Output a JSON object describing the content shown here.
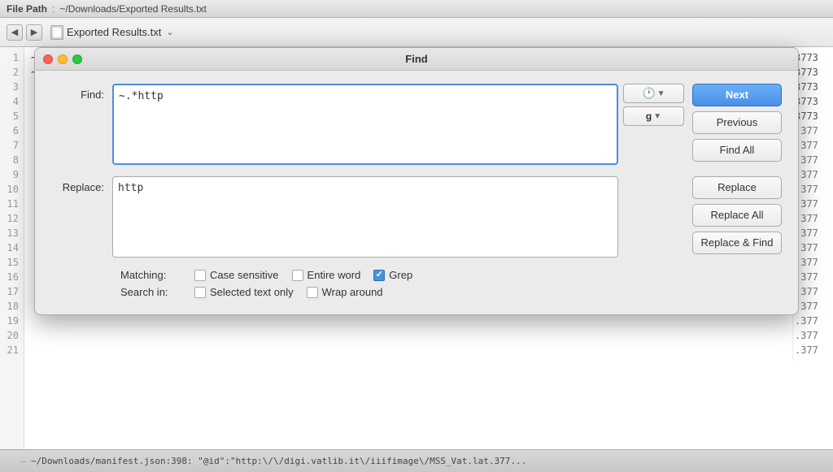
{
  "titlebar": {
    "file_path_label": "File Path",
    "separator": ":",
    "path": "~/Downloads/Exported Results.txt"
  },
  "toolbar": {
    "file_name": "Exported Results.txt",
    "back_icon": "◀",
    "forward_icon": "▶",
    "dropdown_icon": "⌄"
  },
  "editor": {
    "lines": [
      {
        "num": "1",
        "text": "~/Downloads/manifest.json:24: \"@id\":\"http:\\/\\/digi.vatlib.it\\/iiifimage\\/MSS_Vat.lat.3773"
      },
      {
        "num": "2",
        "text": "~/Downloads/manifest.json:41: \"@id\":\"http:\\/\\/digi.vatlib.it\\/iiifimage\\/MSS_Vat.lat.3773"
      },
      {
        "num": "3",
        "text": "                                                                                                   3773"
      },
      {
        "num": "4",
        "text": "                                                                                                   3773"
      },
      {
        "num": "5",
        "text": "                                                                                                   3773"
      },
      {
        "num": "6",
        "text": "                                                                                                    .377"
      },
      {
        "num": "7",
        "text": "                                                                                                    .377"
      },
      {
        "num": "8",
        "text": "                                                                                                    .377"
      },
      {
        "num": "9",
        "text": "                                                                                                    .377"
      },
      {
        "num": "10",
        "text": "                                                                                                   .377"
      },
      {
        "num": "11",
        "text": "                                                                                                   .377"
      },
      {
        "num": "12",
        "text": "                                                                                                   .377"
      },
      {
        "num": "13",
        "text": "                                                                                                   .377"
      },
      {
        "num": "14",
        "text": "                                                                                                   .377"
      },
      {
        "num": "15",
        "text": "                                                                                                   .377"
      },
      {
        "num": "16",
        "text": "                                                                                                   .377"
      },
      {
        "num": "17",
        "text": "                                                                                                   .377"
      },
      {
        "num": "18",
        "text": "                                                                                                   .377"
      },
      {
        "num": "19",
        "text": "                                                                                                   .377"
      },
      {
        "num": "20",
        "text": "                                                                                                   .377"
      },
      {
        "num": "21",
        "text": "                                                                                                   .377"
      }
    ]
  },
  "find_dialog": {
    "title": "Find",
    "find_label": "Find:",
    "replace_label": "Replace:",
    "find_value": "~.*http",
    "replace_value": "http",
    "history_icon": "🕐",
    "regex_icon": "g",
    "next_label": "Next",
    "previous_label": "Previous",
    "find_all_label": "Find All",
    "replace_label_btn": "Replace",
    "replace_all_label": "Replace All",
    "replace_find_label": "Replace & Find",
    "matching_label": "Matching:",
    "search_in_label": "Search in:",
    "options": {
      "case_sensitive": {
        "label": "Case sensitive",
        "checked": false
      },
      "entire_word": {
        "label": "Entire word",
        "checked": false
      },
      "grep": {
        "label": "Grep",
        "checked": true
      },
      "selected_text_only": {
        "label": "Selected text only",
        "checked": false
      },
      "wrap_around": {
        "label": "Wrap around",
        "checked": false
      }
    }
  },
  "status_bar": {
    "line_num": "—",
    "text": "~/Downloads/manifest.json:398: \"@id\":\"http:\\/\\/digi.vatlib.it\\/iiifimage\\/MSS_Vat.lat.377..."
  }
}
